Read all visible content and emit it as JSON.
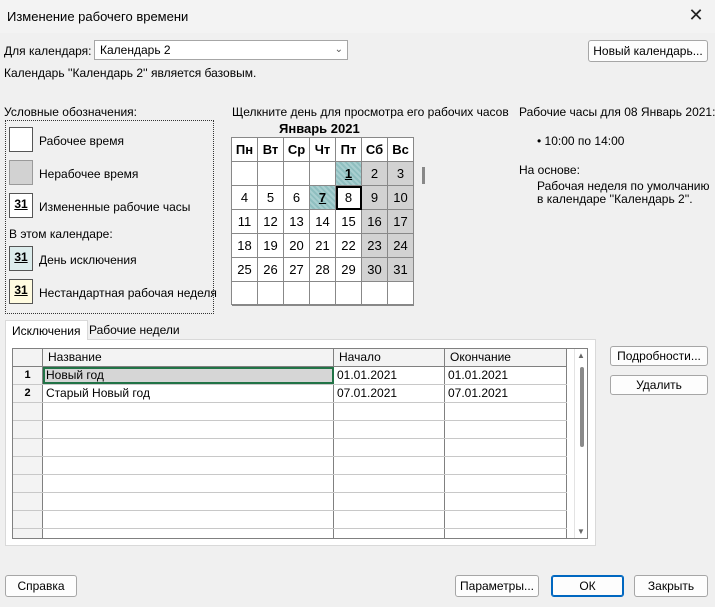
{
  "window": {
    "title": "Изменение рабочего времени"
  },
  "calendar_for": {
    "label": "Для календаря:",
    "value": "Календарь 2",
    "new_calendar_button": "Новый календарь...",
    "base_note": "Календарь ''Календарь 2'' является базовым."
  },
  "legend": {
    "heading": "Условные обозначения:",
    "working": "Рабочее время",
    "nonworking": "Нерабочее время",
    "changed": "Измененные рабочие часы",
    "in_this_calendar": "В этом календаре:",
    "exception_day": "День исключения",
    "nondefault_week": "Нестандартная рабочая неделя",
    "swatch_number": "31"
  },
  "calendar": {
    "instruction": "Щелкните день для просмотра его рабочих часов",
    "month_title": "Январь 2021",
    "weekdays": [
      "Пн",
      "Вт",
      "Ср",
      "Чт",
      "Пт",
      "Сб",
      "Вс"
    ],
    "rows": [
      [
        "",
        "",
        "",
        "",
        "1",
        "2",
        "3"
      ],
      [
        "4",
        "5",
        "6",
        "7",
        "8",
        "9",
        "10"
      ],
      [
        "11",
        "12",
        "13",
        "14",
        "15",
        "16",
        "17"
      ],
      [
        "18",
        "19",
        "20",
        "21",
        "22",
        "23",
        "24"
      ],
      [
        "25",
        "26",
        "27",
        "28",
        "29",
        "30",
        "31"
      ],
      [
        "",
        "",
        "",
        "",
        "",
        "",
        ""
      ]
    ],
    "exception_days": [
      "1",
      "7"
    ],
    "selected_day": "8"
  },
  "working_hours": {
    "heading": "Рабочие часы для 08 Январь 2021:",
    "hours": "• 10:00 по 14:00",
    "based_on_label": "На основе:",
    "based_on_text_line1": "Рабочая неделя по умолчанию",
    "based_on_text_line2": "в календаре ''Календарь 2''."
  },
  "tabs": [
    {
      "label": "Исключения",
      "active": true
    },
    {
      "label": "Рабочие недели",
      "active": false
    }
  ],
  "exceptions_table": {
    "columns": [
      "Название",
      "Начало",
      "Окончание"
    ],
    "rows": [
      {
        "num": "1",
        "name": "Новый год",
        "start": "01.01.2021",
        "end": "01.01.2021"
      },
      {
        "num": "2",
        "name": "Старый Новый год",
        "start": "07.01.2021",
        "end": "07.01.2021"
      }
    ],
    "empty_rows": 8
  },
  "side_buttons": {
    "details": "Подробности...",
    "delete": "Удалить"
  },
  "footer": {
    "help": "Справка",
    "options": "Параметры...",
    "ok": "ОК",
    "close": "Закрыть"
  }
}
